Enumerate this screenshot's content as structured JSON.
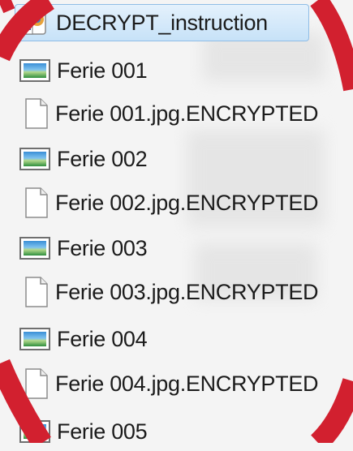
{
  "files": [
    {
      "name": "DECRYPT_instruction",
      "icon": "internet-shortcut-icon",
      "selected": true
    },
    {
      "name": "Ferie 001",
      "icon": "image-file-icon"
    },
    {
      "name": "Ferie 001.jpg.ENCRYPTED",
      "icon": "blank-document-icon"
    },
    {
      "name": "Ferie 002",
      "icon": "image-file-icon"
    },
    {
      "name": "Ferie 002.jpg.ENCRYPTED",
      "icon": "blank-document-icon"
    },
    {
      "name": "Ferie 003",
      "icon": "image-file-icon"
    },
    {
      "name": "Ferie 003.jpg.ENCRYPTED",
      "icon": "blank-document-icon"
    },
    {
      "name": "Ferie 004",
      "icon": "image-file-icon"
    },
    {
      "name": "Ferie 004.jpg.ENCRYPTED",
      "icon": "blank-document-icon"
    },
    {
      "name": "Ferie 005",
      "icon": "image-file-icon"
    }
  ],
  "colors": {
    "prohibition_red": "#d2202f",
    "selection_fill": "#cfe6fa",
    "selection_border": "#8fbde6",
    "text": "#1b1b1b"
  }
}
